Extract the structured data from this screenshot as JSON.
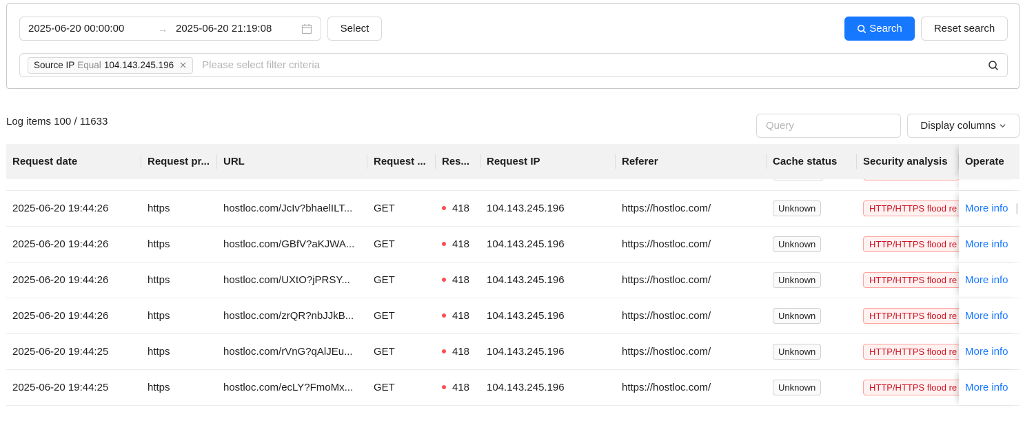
{
  "filters": {
    "range_start": "2025-06-20 00:00:00",
    "range_separator": "→",
    "range_end": "2025-06-20 21:19:08",
    "select_label": "Select",
    "search_label": "Search",
    "reset_label": "Reset search",
    "active_filter": {
      "field": "Source IP",
      "operator": "Equal",
      "value": "104.143.245.196"
    },
    "filter_placeholder": "Please select filter criteria"
  },
  "toolbar": {
    "log_count": "Log items 100 / 11633",
    "query_placeholder": "Query",
    "columns_label": "Display columns"
  },
  "table": {
    "columns": [
      "Request date",
      "Request pr...",
      "URL",
      "Request ...",
      "Res...",
      "Request IP",
      "Referer",
      "Cache status",
      "Security analysis",
      "Operate"
    ],
    "rows": [
      {
        "date": "2025-06-20 19:44:26",
        "protocol": "https",
        "url": "hostloc.com/JcIv?bhaelILT...",
        "method": "GET",
        "status": "418",
        "ip": "104.143.245.196",
        "referer": "https://hostloc.com/",
        "cache": "Unknown",
        "security": "HTTP/HTTPS flood re",
        "action": "More info"
      },
      {
        "date": "2025-06-20 19:44:26",
        "protocol": "https",
        "url": "hostloc.com/GBfV?aKJWA...",
        "method": "GET",
        "status": "418",
        "ip": "104.143.245.196",
        "referer": "https://hostloc.com/",
        "cache": "Unknown",
        "security": "HTTP/HTTPS flood re",
        "action": "More info"
      },
      {
        "date": "2025-06-20 19:44:26",
        "protocol": "https",
        "url": "hostloc.com/UXtO?jPRSY...",
        "method": "GET",
        "status": "418",
        "ip": "104.143.245.196",
        "referer": "https://hostloc.com/",
        "cache": "Unknown",
        "security": "HTTP/HTTPS flood re",
        "action": "More info"
      },
      {
        "date": "2025-06-20 19:44:26",
        "protocol": "https",
        "url": "hostloc.com/zrQR?nbJJkB...",
        "method": "GET",
        "status": "418",
        "ip": "104.143.245.196",
        "referer": "https://hostloc.com/",
        "cache": "Unknown",
        "security": "HTTP/HTTPS flood re",
        "action": "More info"
      },
      {
        "date": "2025-06-20 19:44:25",
        "protocol": "https",
        "url": "hostloc.com/rVnG?qAlJEu...",
        "method": "GET",
        "status": "418",
        "ip": "104.143.245.196",
        "referer": "https://hostloc.com/",
        "cache": "Unknown",
        "security": "HTTP/HTTPS flood re",
        "action": "More info"
      },
      {
        "date": "2025-06-20 19:44:25",
        "protocol": "https",
        "url": "hostloc.com/ecLY?FmoMx...",
        "method": "GET",
        "status": "418",
        "ip": "104.143.245.196",
        "referer": "https://hostloc.com/",
        "cache": "Unknown",
        "security": "HTTP/HTTPS flood re",
        "action": "More info"
      }
    ]
  },
  "colors": {
    "accent": "#1677ff",
    "status_dot": "#ff4d4f",
    "security_text": "#cf1322",
    "security_border": "#ffa39e"
  }
}
